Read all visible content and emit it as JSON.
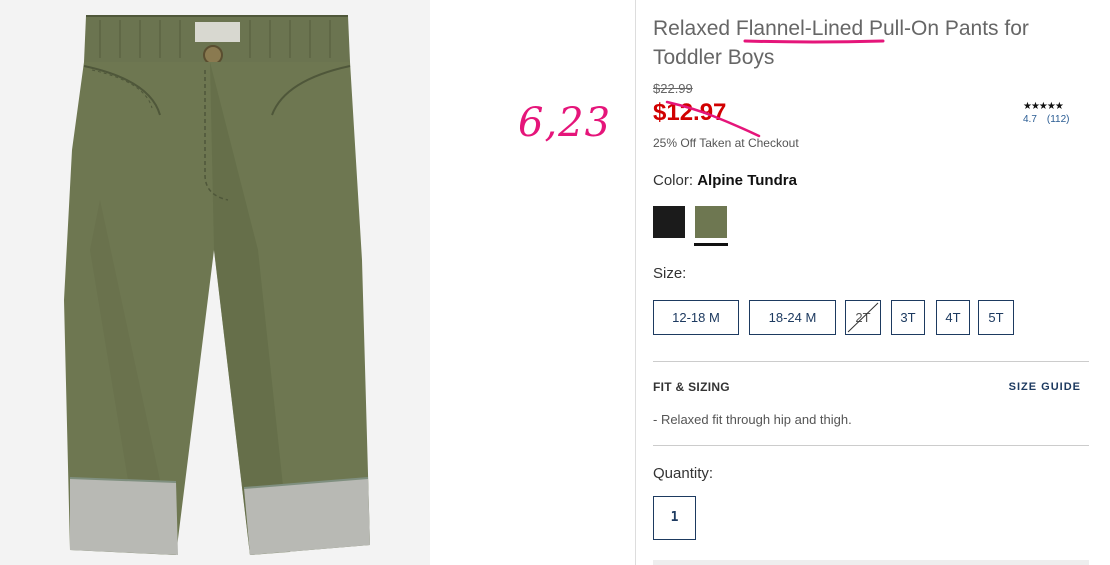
{
  "product": {
    "title_before": "Relaxed ",
    "title_highlight": "Flannel-Lined",
    "title_after": " Pull-On Pants for Toddler Boys",
    "was_price": "$22.99",
    "sale_price": "$12.97",
    "promo": "25% Off Taken at Checkout",
    "rating": {
      "stars": "★★★★★",
      "score": "4.7",
      "count": "(112)"
    },
    "color": {
      "label": "Color:",
      "value": "Alpine Tundra"
    },
    "swatches": [
      {
        "name": "black",
        "color": "#1b1b1b"
      },
      {
        "name": "olive",
        "color": "#6e7751",
        "selected": true
      }
    ],
    "size_label": "Size:",
    "sizes": [
      {
        "label": "12-18 M",
        "available": true
      },
      {
        "label": "18-24 M",
        "available": true
      },
      {
        "label": "2T",
        "available": false
      },
      {
        "label": "3T",
        "available": true
      },
      {
        "label": "4T",
        "available": true
      },
      {
        "label": "5T",
        "available": true
      }
    ],
    "fit": {
      "heading": "FIT & SIZING",
      "guide_link": "SIZE GUIDE",
      "bullet": "-  Relaxed fit through hip and thigh."
    },
    "quantity": {
      "label": "Quantity:",
      "value": "1"
    }
  },
  "annotation": {
    "handwritten_price": "6,23",
    "color": "#e5157a"
  },
  "colors": {
    "sale_red": "#d10000",
    "navy": "#1d3a60",
    "olive": "#6e7751"
  }
}
